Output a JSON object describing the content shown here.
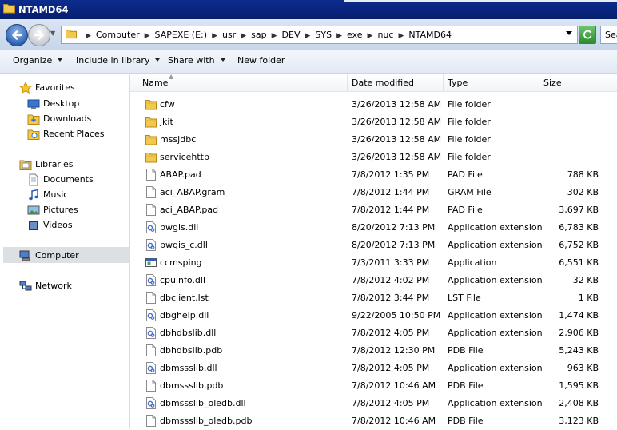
{
  "window": {
    "title": "NTAMD64"
  },
  "address": {
    "crumbs": [
      "Computer",
      "SAPEXE (E:)",
      "usr",
      "sap",
      "DEV",
      "SYS",
      "exe",
      "nuc",
      "NTAMD64"
    ],
    "search_placeholder": "Sea"
  },
  "toolbar": {
    "organize": "Organize",
    "include_in_library": "Include in library",
    "share_with": "Share with",
    "new_folder": "New folder"
  },
  "nav": {
    "favorites": "Favorites",
    "desktop": "Desktop",
    "downloads": "Downloads",
    "recent_places": "Recent Places",
    "libraries": "Libraries",
    "documents": "Documents",
    "music": "Music",
    "pictures": "Pictures",
    "videos": "Videos",
    "computer": "Computer",
    "network": "Network"
  },
  "columns": {
    "name": "Name",
    "date_modified": "Date modified",
    "type": "Type",
    "size": "Size"
  },
  "files": [
    {
      "icon": "folder",
      "name": "cfw",
      "date": "3/26/2013 12:58 AM",
      "type": "File folder",
      "size": ""
    },
    {
      "icon": "folder",
      "name": "jkit",
      "date": "3/26/2013 12:58 AM",
      "type": "File folder",
      "size": ""
    },
    {
      "icon": "folder",
      "name": "mssjdbc",
      "date": "3/26/2013 12:58 AM",
      "type": "File folder",
      "size": ""
    },
    {
      "icon": "folder",
      "name": "servicehttp",
      "date": "3/26/2013 12:58 AM",
      "type": "File folder",
      "size": ""
    },
    {
      "icon": "file",
      "name": "ABAP.pad",
      "date": "7/8/2012 1:35 PM",
      "type": "PAD File",
      "size": "788 KB"
    },
    {
      "icon": "file",
      "name": "aci_ABAP.gram",
      "date": "7/8/2012 1:44 PM",
      "type": "GRAM File",
      "size": "302 KB"
    },
    {
      "icon": "file",
      "name": "aci_ABAP.pad",
      "date": "7/8/2012 1:44 PM",
      "type": "PAD File",
      "size": "3,697 KB"
    },
    {
      "icon": "dll",
      "name": "bwgis.dll",
      "date": "8/20/2012 7:13 PM",
      "type": "Application extension",
      "size": "6,783 KB"
    },
    {
      "icon": "dll",
      "name": "bwgis_c.dll",
      "date": "8/20/2012 7:13 PM",
      "type": "Application extension",
      "size": "6,752 KB"
    },
    {
      "icon": "app",
      "name": "ccmsping",
      "date": "7/3/2011 3:33 PM",
      "type": "Application",
      "size": "6,551 KB"
    },
    {
      "icon": "dll",
      "name": "cpuinfo.dll",
      "date": "7/8/2012 4:02 PM",
      "type": "Application extension",
      "size": "32 KB"
    },
    {
      "icon": "file",
      "name": "dbclient.lst",
      "date": "7/8/2012 3:44 PM",
      "type": "LST File",
      "size": "1 KB"
    },
    {
      "icon": "dll",
      "name": "dbghelp.dll",
      "date": "9/22/2005 10:50 PM",
      "type": "Application extension",
      "size": "1,474 KB"
    },
    {
      "icon": "dll",
      "name": "dbhdbslib.dll",
      "date": "7/8/2012 4:05 PM",
      "type": "Application extension",
      "size": "2,906 KB"
    },
    {
      "icon": "file",
      "name": "dbhdbslib.pdb",
      "date": "7/8/2012 12:30 PM",
      "type": "PDB File",
      "size": "5,243 KB"
    },
    {
      "icon": "dll",
      "name": "dbmssslib.dll",
      "date": "7/8/2012 4:05 PM",
      "type": "Application extension",
      "size": "963 KB"
    },
    {
      "icon": "file",
      "name": "dbmssslib.pdb",
      "date": "7/8/2012 10:46 AM",
      "type": "PDB File",
      "size": "1,595 KB"
    },
    {
      "icon": "dll",
      "name": "dbmssslib_oledb.dll",
      "date": "7/8/2012 4:05 PM",
      "type": "Application extension",
      "size": "2,408 KB"
    },
    {
      "icon": "file",
      "name": "dbmssslib_oledb.pdb",
      "date": "7/8/2012 10:46 AM",
      "type": "PDB File",
      "size": "3,123 KB"
    }
  ]
}
